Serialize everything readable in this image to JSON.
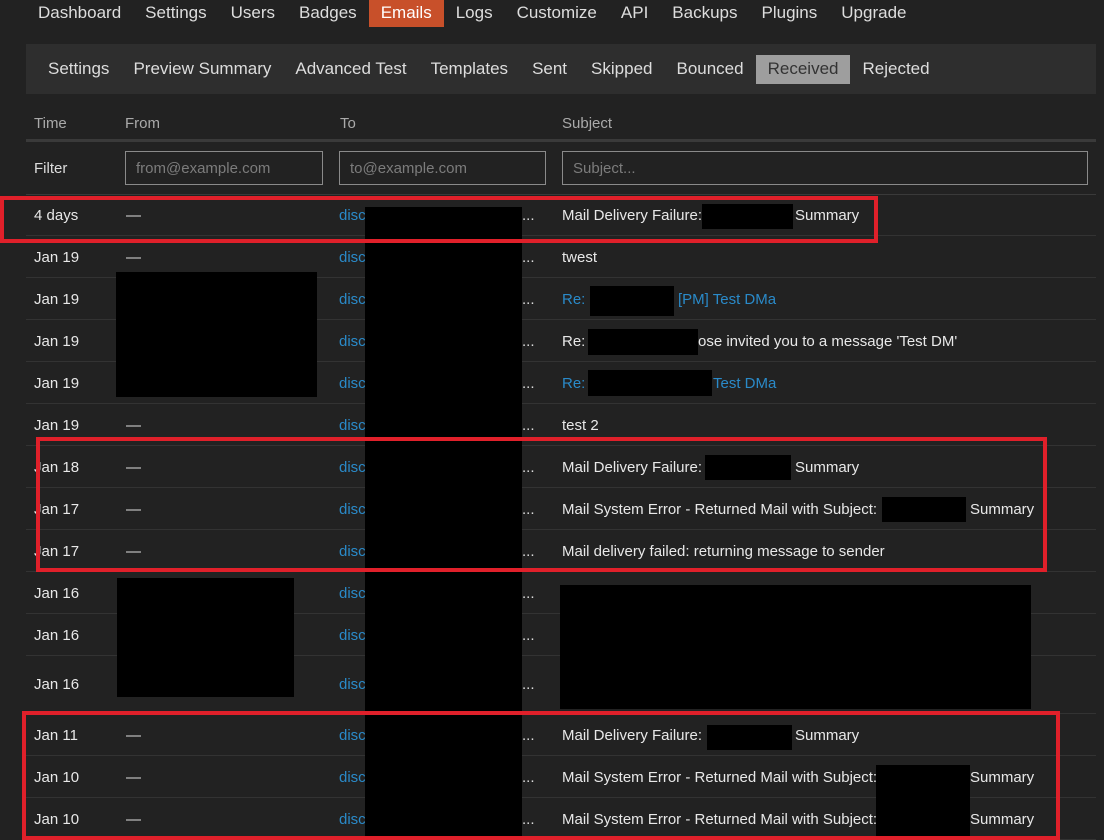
{
  "top_nav": [
    {
      "label": "Dashboard",
      "active": false
    },
    {
      "label": "Settings",
      "active": false
    },
    {
      "label": "Users",
      "active": false
    },
    {
      "label": "Badges",
      "active": false
    },
    {
      "label": "Emails",
      "active": true
    },
    {
      "label": "Logs",
      "active": false
    },
    {
      "label": "Customize",
      "active": false
    },
    {
      "label": "API",
      "active": false
    },
    {
      "label": "Backups",
      "active": false
    },
    {
      "label": "Plugins",
      "active": false
    },
    {
      "label": "Upgrade",
      "active": false
    }
  ],
  "sub_nav": [
    {
      "label": "Settings",
      "active": false
    },
    {
      "label": "Preview Summary",
      "active": false
    },
    {
      "label": "Advanced Test",
      "active": false
    },
    {
      "label": "Templates",
      "active": false
    },
    {
      "label": "Sent",
      "active": false
    },
    {
      "label": "Skipped",
      "active": false
    },
    {
      "label": "Bounced",
      "active": false
    },
    {
      "label": "Received",
      "active": true
    },
    {
      "label": "Rejected",
      "active": false
    }
  ],
  "table": {
    "headers": {
      "time": "Time",
      "from": "From",
      "to": "To",
      "subject": "Subject"
    },
    "filter": {
      "label": "Filter",
      "from_placeholder": "from@example.com",
      "to_placeholder": "to@example.com",
      "subject_placeholder": "Subject..."
    },
    "rows": [
      {
        "time": "4 days",
        "from": "—",
        "to": "disc",
        "ellipsis": "...",
        "subject": "Mail Delivery Failure:",
        "subject_tail": "Summary"
      },
      {
        "time": "Jan 19",
        "from": "—",
        "to": "disc",
        "ellipsis": "...",
        "subject": "twest",
        "subject_tail": ""
      },
      {
        "time": "Jan 19",
        "from": "",
        "to": "disc",
        "ellipsis": "...",
        "subject": "Re:",
        "subject_tail": "[PM] Test DMa",
        "link": true
      },
      {
        "time": "Jan 19",
        "from": "",
        "to": "disc",
        "ellipsis": "...",
        "subject": "Re:",
        "subject_tail": "ose invited you to a message 'Test DM'"
      },
      {
        "time": "Jan 19",
        "from": "",
        "to": "disc",
        "ellipsis": "...",
        "subject": "Re:",
        "subject_tail": "Test DMa",
        "link": true
      },
      {
        "time": "Jan 19",
        "from": "—",
        "to": "disc",
        "ellipsis": "...",
        "subject": "test 2",
        "subject_tail": ""
      },
      {
        "time": "Jan 18",
        "from": "—",
        "to": "disc",
        "ellipsis": "...",
        "subject": "Mail Delivery Failure:",
        "subject_tail": "Summary"
      },
      {
        "time": "Jan 17",
        "from": "—",
        "to": "disc",
        "ellipsis": "...",
        "subject": "Mail System Error - Returned Mail with Subject:",
        "subject_tail": "Summary"
      },
      {
        "time": "Jan 17",
        "from": "—",
        "to": "disc",
        "ellipsis": "...",
        "subject": "Mail delivery failed: returning message to sender",
        "subject_tail": ""
      },
      {
        "time": "Jan 16",
        "from": "",
        "to": "disc",
        "ellipsis": "...",
        "subject": "",
        "subject_tail": ""
      },
      {
        "time": "Jan 16",
        "from": "",
        "to": "disc",
        "ellipsis": "...",
        "subject": "",
        "subject_tail": ""
      },
      {
        "time": "Jan 16",
        "from": "",
        "to": "disc",
        "ellipsis": "...",
        "subject": "",
        "subject_tail": ""
      },
      {
        "time": "Jan 11",
        "from": "—",
        "to": "disc",
        "ellipsis": "...",
        "subject": "Mail Delivery Failure:",
        "subject_tail": "Summary"
      },
      {
        "time": "Jan 10",
        "from": "—",
        "to": "disc",
        "ellipsis": "...",
        "subject": "Mail System Error - Returned Mail with Subject:",
        "subject_tail": "Summary"
      },
      {
        "time": "Jan 10",
        "from": "—",
        "to": "disc",
        "ellipsis": "...",
        "subject": "Mail System Error - Returned Mail with Subject:",
        "subject_tail": "Summary"
      }
    ]
  },
  "colors": {
    "accent": "#c8502a",
    "link": "#2a8ac9",
    "highlight": "#e0202a",
    "background": "#222222"
  }
}
